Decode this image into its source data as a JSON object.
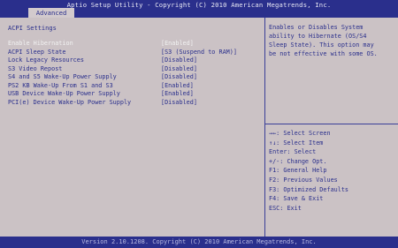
{
  "header": {
    "title": "Aptio Setup Utility - Copyright (C) 2010 American Megatrends, Inc.",
    "tab": "Advanced"
  },
  "section_title": "ACPI Settings",
  "settings": [
    {
      "label": "Enable Hibernation",
      "value": "[Enabled]"
    },
    {
      "label": "ACPI Sleep State",
      "value": "[S3 (Suspend to RAM)]"
    },
    {
      "label": "Lock Legacy Resources",
      "value": "[Disabled]"
    },
    {
      "label": "S3 Video Repost",
      "value": "[Disabled]"
    },
    {
      "label": "S4 and S5 Wake-Up Power Supply",
      "value": "[Disabled]"
    },
    {
      "label": "PS2 KB Wake-Up From S1 and S3",
      "value": "[Enabled]"
    },
    {
      "label": "USB Device Wake-Up Power Supply",
      "value": "[Enabled]"
    },
    {
      "label": "PCI(e) Device Wake-Up Power Supply",
      "value": "[Disabled]"
    }
  ],
  "help_lines": [
    "Enables or Disables System",
    "ability to Hibernate (OS/S4",
    "Sleep State). This option may",
    "be not effective with some OS."
  ],
  "keys": [
    "→←: Select Screen",
    "↑↓: Select Item",
    "Enter: Select",
    "+/-: Change Opt.",
    "F1: General Help",
    "F2: Previous Values",
    "F3: Optimized Defaults",
    "F4: Save & Exit",
    "ESC: Exit"
  ],
  "footer": "Version 2.10.1208. Copyright (C) 2010 American Megatrends, Inc."
}
